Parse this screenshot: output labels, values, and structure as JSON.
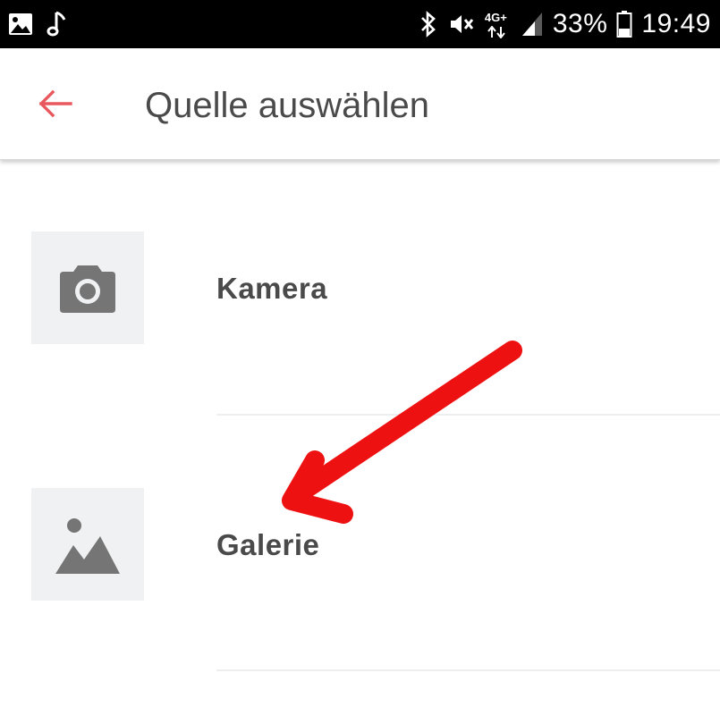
{
  "status_bar": {
    "battery": "33%",
    "time": "19:49",
    "network": "4G+",
    "icons": [
      "image-icon",
      "music-note-icon",
      "bluetooth-icon",
      "vibrate-icon",
      "signal-icon",
      "battery-icon"
    ]
  },
  "app_bar": {
    "title": "Quelle auswählen",
    "back_icon": "arrow-back-icon"
  },
  "sources": [
    {
      "label": "Kamera",
      "icon": "camera-icon"
    },
    {
      "label": "Galerie",
      "icon": "image-icon"
    }
  ],
  "colors": {
    "accent": "#e8595f",
    "text": "#4a4a4a",
    "thumb_bg": "#eff1f3",
    "icon_gray": "#757575",
    "annotation": "#ee1111",
    "status_bg": "#000000"
  }
}
